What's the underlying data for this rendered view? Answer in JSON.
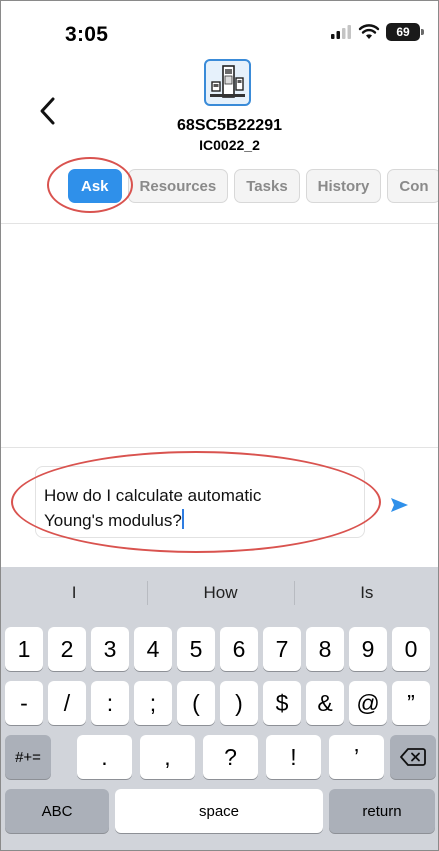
{
  "status_bar": {
    "time": "3:05",
    "battery": "69"
  },
  "header": {
    "device_id": "68SC5B22291",
    "device_sub": "IC0022_2"
  },
  "tabs": [
    {
      "label": "Ask"
    },
    {
      "label": "Resources"
    },
    {
      "label": "Tasks"
    },
    {
      "label": "History"
    },
    {
      "label": "Con"
    }
  ],
  "chat": {
    "input_line1": "How do I calculate automatic",
    "input_line2": "Young's modulus?"
  },
  "keyboard": {
    "suggestions": [
      "I",
      "How",
      "Is"
    ],
    "row1": [
      "1",
      "2",
      "3",
      "4",
      "5",
      "6",
      "7",
      "8",
      "9",
      "0"
    ],
    "row2": [
      "-",
      "/",
      ":",
      ";",
      "(",
      ")",
      "$",
      "&",
      "@",
      "”"
    ],
    "row3_mode": "#+=",
    "row3": [
      ".",
      ",",
      "?",
      "!",
      "’"
    ],
    "abc_label": "ABC",
    "space_label": "space",
    "return_label": "return"
  },
  "colors": {
    "accent": "#2f90ea",
    "annotation": "#d9534f",
    "keyboard_bg": "#d1d4da"
  },
  "icons": [
    "back-chevron-icon",
    "device-icon",
    "signal-icon",
    "wifi-icon",
    "battery-icon",
    "send-icon",
    "backspace-icon"
  ]
}
